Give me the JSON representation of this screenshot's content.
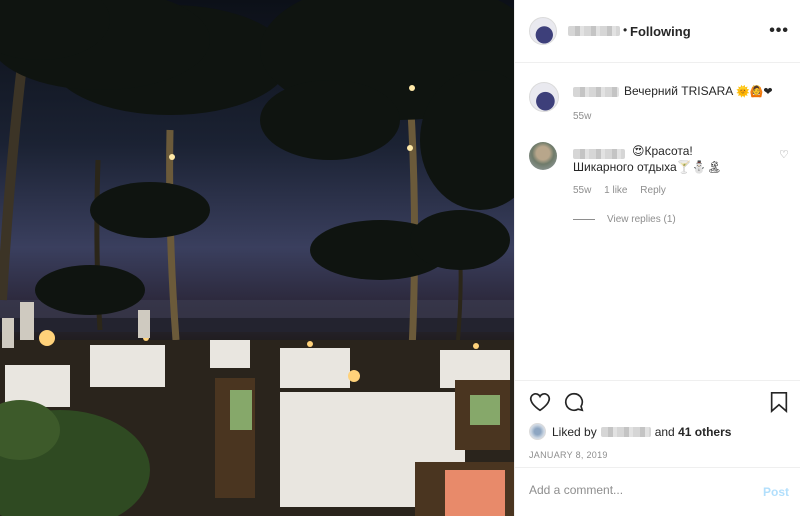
{
  "header": {
    "separator": "•",
    "follow_label": "Following",
    "more_label": "•••"
  },
  "caption": {
    "text": "Вечерний TRISARA",
    "emojis": "🌞🙆❤",
    "time": "55w"
  },
  "comment": {
    "line1": "😍Красота!",
    "line2": "Шикарного отдыха🍸⛄🏝",
    "time": "55w",
    "likes": "1 like",
    "reply": "Reply",
    "heart": "♡"
  },
  "view_replies": "View replies (1)",
  "actions": {
    "icons": [
      "heart-icon",
      "comment-icon",
      "bookmark-icon"
    ]
  },
  "likes": {
    "prefix": "Liked by",
    "suffix": "and",
    "others": "41 others"
  },
  "date": "JANUARY 8, 2019",
  "add_comment": {
    "placeholder": "Add a comment...",
    "post_label": "Post"
  },
  "colors": {
    "border": "#efefef",
    "text": "#262626",
    "muted": "#8e8e8e",
    "post_disabled": "#b2dffc"
  }
}
